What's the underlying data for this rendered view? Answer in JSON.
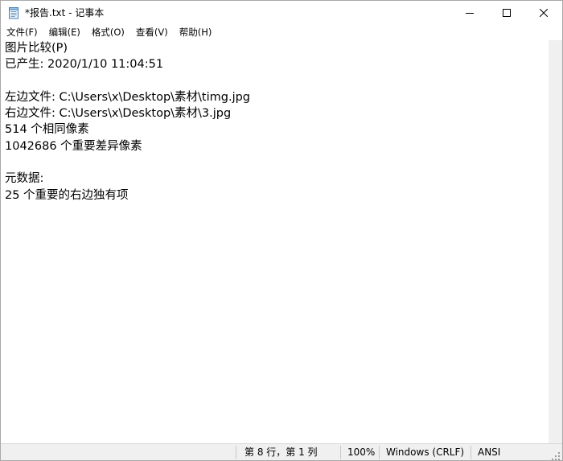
{
  "window": {
    "title": "*报告.txt - 记事本",
    "icon": "notepad-icon"
  },
  "titlebar_buttons": {
    "minimize_icon": "minimize-icon",
    "maximize_icon": "maximize-icon",
    "close_icon": "close-icon"
  },
  "menu": {
    "items": [
      {
        "label": "文件(F)"
      },
      {
        "label": "编辑(E)"
      },
      {
        "label": "格式(O)"
      },
      {
        "label": "查看(V)"
      },
      {
        "label": "帮助(H)"
      }
    ]
  },
  "editor": {
    "lines": [
      "图片比较(P)",
      "已产生: 2020/1/10 11:04:51",
      "",
      "左边文件: C:\\Users\\x\\Desktop\\素材\\timg.jpg",
      "右边文件: C:\\Users\\x\\Desktop\\素材\\3.jpg",
      "514 个相同像素",
      "1042686 个重要差异像素",
      "",
      "元数据:",
      "25 个重要的右边独有项"
    ]
  },
  "status": {
    "position": "第 8 行，第 1 列",
    "zoom": "100%",
    "line_ending": "Windows (CRLF)",
    "encoding": "ANSI"
  },
  "colors": {
    "window_bg": "#ffffff",
    "statusbar_bg": "#f0f0f0",
    "border": "#a9a9a9"
  }
}
